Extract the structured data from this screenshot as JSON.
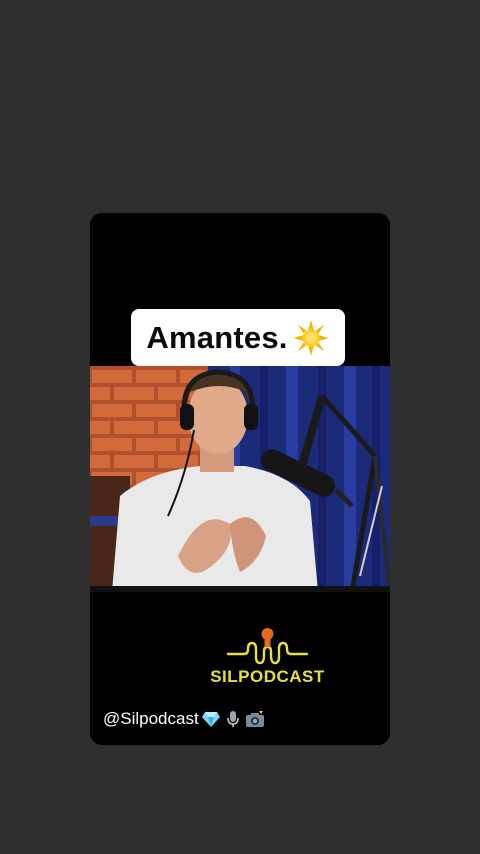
{
  "story": {
    "caption": "Amantes.",
    "caption_emoji": "sun-emoji-icon",
    "logo_text": "SILPODCAST",
    "handle": "@Silpodcast",
    "handle_icons": [
      "diamond-icon",
      "microphone-icon",
      "camera-icon"
    ]
  },
  "colors": {
    "background": "#2f2f2f",
    "card": "#000000",
    "logo_yellow": "#e8e03a",
    "logo_orange": "#e36a1f"
  }
}
